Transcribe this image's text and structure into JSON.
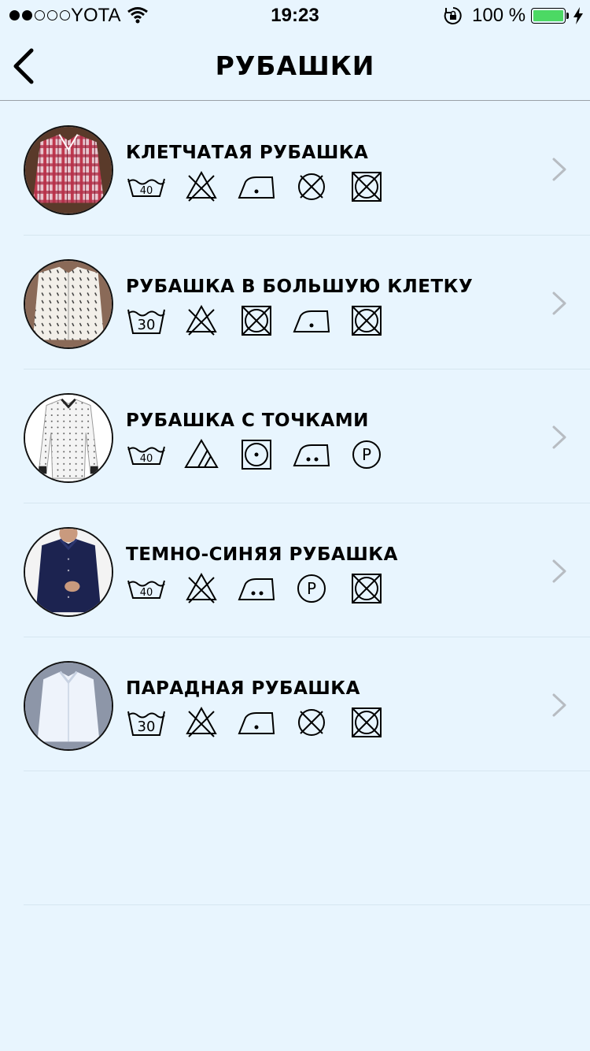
{
  "status_bar": {
    "carrier": "YOTA",
    "time": "19:23",
    "battery_percent": "100 %",
    "signal_strength": 2,
    "signal_max": 5,
    "battery_color": "#4cd964"
  },
  "nav": {
    "title": "РУБАШКИ",
    "back_icon": "chevron-left-icon"
  },
  "items": [
    {
      "title": "КЛЕТЧАТАЯ РУБАШКА",
      "thumb": "plaid-shirt-photo",
      "care_icons": [
        {
          "name": "wash-40-icon",
          "label": "40"
        },
        {
          "name": "do-not-bleach-icon"
        },
        {
          "name": "iron-low-icon"
        },
        {
          "name": "do-not-dry-clean-icon"
        },
        {
          "name": "do-not-tumble-dry-icon"
        }
      ]
    },
    {
      "title": "РУБАШКА В БОЛЬШУЮ КЛЕТКУ",
      "thumb": "white-patterned-shirt-photo",
      "care_icons": [
        {
          "name": "wash-30-icon",
          "label": "30"
        },
        {
          "name": "do-not-bleach-icon"
        },
        {
          "name": "do-not-tumble-dry-icon"
        },
        {
          "name": "iron-low-icon"
        },
        {
          "name": "do-not-tumble-dry-icon"
        }
      ]
    },
    {
      "title": "РУБАШКА С ТОЧКАМИ",
      "thumb": "white-dotted-shirt-photo",
      "care_icons": [
        {
          "name": "wash-40-icon",
          "label": "40"
        },
        {
          "name": "non-chlorine-bleach-icon"
        },
        {
          "name": "tumble-dry-low-icon"
        },
        {
          "name": "iron-medium-icon"
        },
        {
          "name": "dry-clean-p-icon",
          "label": "P"
        }
      ]
    },
    {
      "title": "ТЕМНО-СИНЯЯ РУБАШКА",
      "thumb": "navy-shirt-photo",
      "care_icons": [
        {
          "name": "wash-40-icon",
          "label": "40"
        },
        {
          "name": "do-not-bleach-icon"
        },
        {
          "name": "iron-medium-icon"
        },
        {
          "name": "dry-clean-p-icon",
          "label": "P"
        },
        {
          "name": "do-not-tumble-dry-icon"
        }
      ]
    },
    {
      "title": "ПАРАДНАЯ РУБАШКА",
      "thumb": "white-dress-shirt-photo",
      "care_icons": [
        {
          "name": "wash-30-icon",
          "label": "30"
        },
        {
          "name": "do-not-bleach-icon"
        },
        {
          "name": "iron-low-icon"
        },
        {
          "name": "do-not-dry-clean-icon"
        },
        {
          "name": "do-not-tumble-dry-icon"
        }
      ]
    }
  ]
}
